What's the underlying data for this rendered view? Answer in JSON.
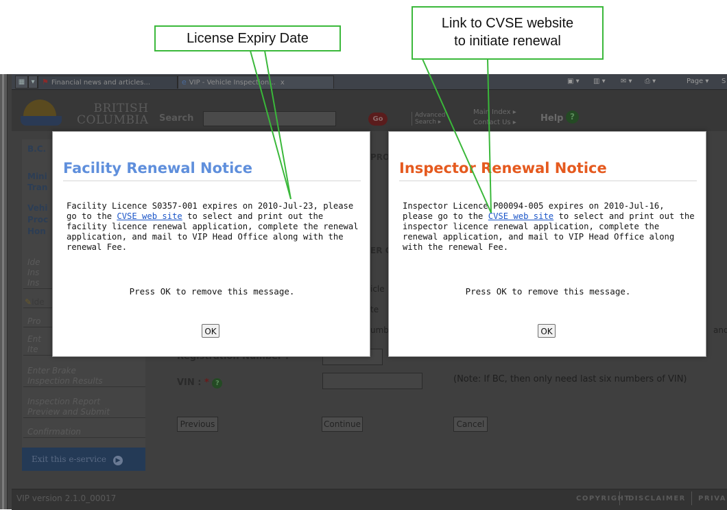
{
  "browser": {
    "tabs": [
      {
        "label": "Financial news and articles..."
      },
      {
        "label": "VIP - Vehicle Inspection...",
        "close": "x"
      }
    ],
    "page_menu": "Page",
    "page_menu_cut": "S"
  },
  "header": {
    "logo_line1": "BRITISH",
    "logo_line2": "COLUMBIA",
    "search_label": "Search",
    "go_label": "Go",
    "advanced_line1": "Advanced",
    "advanced_line2": "Search ▸",
    "main_index": "Main Index ▸",
    "contact_us": "Contact Us ▸",
    "help_label": "Help",
    "help_glyph": "?"
  },
  "sidebar": {
    "fragments": [
      "B.C.",
      "Mini",
      "Tran",
      "Vehi",
      "Proc",
      "Hon"
    ],
    "items": [
      {
        "label": "Ide"
      },
      {
        "label": "Ins"
      },
      {
        "label": "Ins"
      },
      {
        "label": "Ide"
      },
      {
        "label": "Pro"
      },
      {
        "label": "Ent"
      },
      {
        "label": "Ite"
      },
      {
        "label": "Enter Brake"
      },
      {
        "label": "Inspection Results"
      },
      {
        "label": "Inspection Report"
      },
      {
        "label": "Preview and Submit"
      },
      {
        "label": "Confirmation"
      }
    ],
    "exit_label": "Exit this e-service"
  },
  "form": {
    "header_fragment_pro": "PRO",
    "header_fragment_er": "ER C",
    "frag_icle": "icle",
    "frag_te": "te",
    "frag_umb": "umb",
    "frag_and": "and",
    "registration_label": "Registration Number :",
    "vin_label": "VIN :",
    "required_mark": "*",
    "vin_note": "(Note: If BC, then only need last six numbers of VIN)",
    "previous_label": "Previous",
    "continue_label": "Continue",
    "cancel_label": "Cancel"
  },
  "footer": {
    "version": "VIP version 2.1.0_00017",
    "copyright": "COPYRIGHT",
    "disclaimer": "DISCLAIMER",
    "privacy": "PRIVA"
  },
  "facility_modal": {
    "title": "Facility Renewal Notice",
    "title_color": "#5f8fdc",
    "body_before": "Facility Licence S0357-001 expires on 2010-Jul-23, please go to the ",
    "link_text": "CVSE web site",
    "body_after": " to select and print out the facility licence renewal application, complete the renewal application, and mail to VIP Head Office along with the renewal Fee.",
    "press_ok": "Press OK to remove this message.",
    "ok_label": "OK"
  },
  "inspector_modal": {
    "title": "Inspector Renewal Notice",
    "title_color": "#e55a1f",
    "body_before": "Inspector Licence P00094-005 expires on 2010-Jul-16, please go to the ",
    "link_text": "CVSE web site",
    "body_after": " to select and print out the inspector licence renewal application, complete the renewal application, and mail to VIP Head Office along with the renewal Fee.",
    "press_ok": "Press OK to remove this message.",
    "ok_label": "OK"
  },
  "annotations": {
    "expiry_callout": "License Expiry Date",
    "link_callout_line1": "Link to CVSE website",
    "link_callout_line2": "to initiate renewal",
    "accent_color": "#3ab83a"
  }
}
